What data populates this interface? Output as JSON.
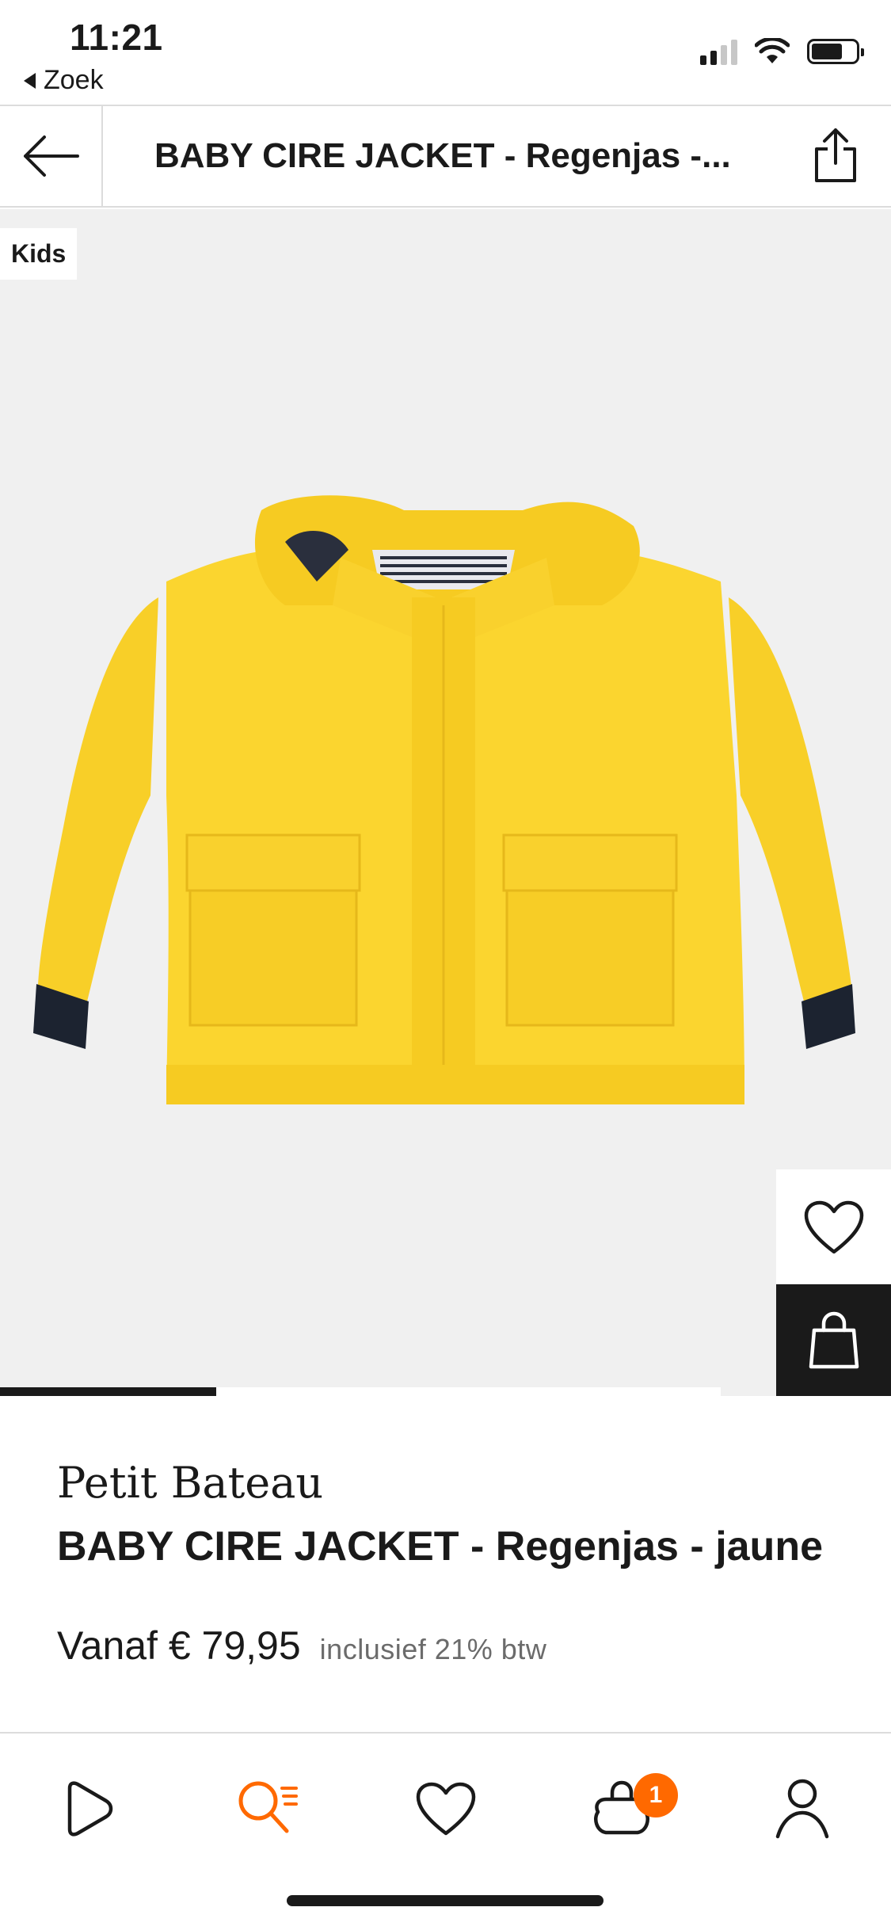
{
  "status_bar": {
    "time": "11:21",
    "back_label": "Zoek",
    "icons": [
      "signal-icon",
      "wifi-icon",
      "battery-icon"
    ]
  },
  "header": {
    "title": "BABY CIRE JACKET - Regenjas -...",
    "back_icon": "arrow-left-icon",
    "share_icon": "share-icon"
  },
  "gallery": {
    "badge": "Kids",
    "image": "yellow-rain-jacket",
    "progress_fraction": 0.3,
    "favorite_icon": "heart-icon",
    "add_to_bag_icon": "bag-icon"
  },
  "product": {
    "brand": "Petit Bateau",
    "name": "BABY CIRE JACKET - Regenjas - jaune",
    "price": "Vanaf € 79,95",
    "tax_note": "inclusief 21% btw"
  },
  "bottom_nav": {
    "items": [
      "home-icon",
      "search-icon",
      "wishlist-icon",
      "cart-icon",
      "profile-icon"
    ],
    "cart_count": "1"
  },
  "colors": {
    "accent": "#ff6900",
    "text": "#1a1a1a",
    "jacket": "#fbd52f",
    "background_gallery": "#f0f0f0"
  }
}
